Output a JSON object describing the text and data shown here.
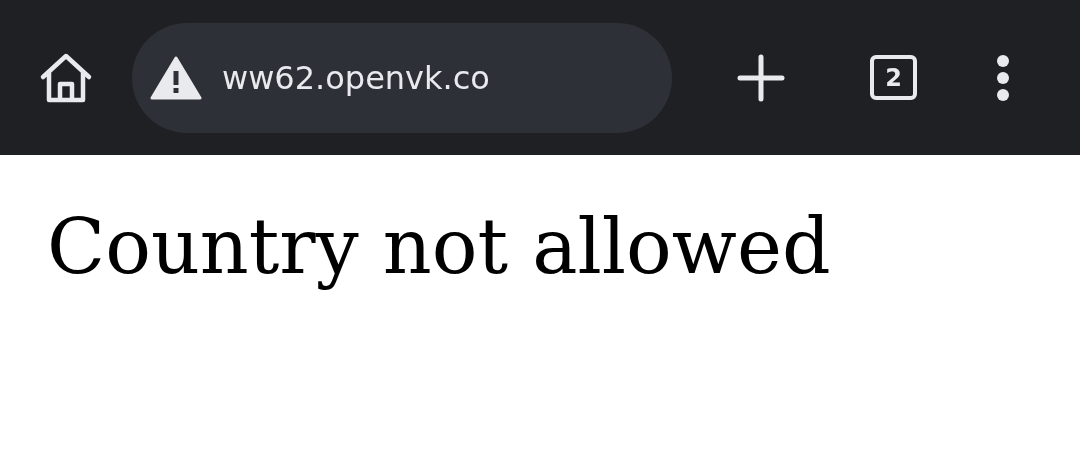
{
  "toolbar": {
    "url": "ww62.openvk.co",
    "tab_count": "2"
  },
  "page": {
    "heading": "Country not allowed"
  }
}
